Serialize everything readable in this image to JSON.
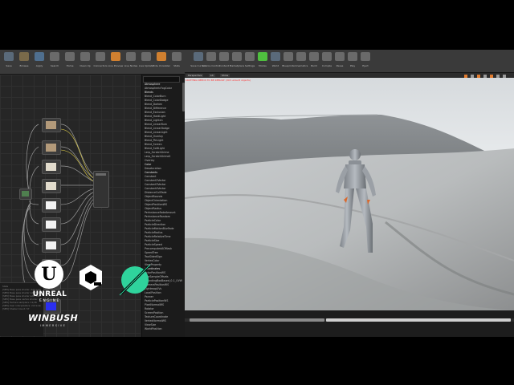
{
  "left_toolbar": {
    "buttons": [
      {
        "label": "Save",
        "color": "#5a6a7a"
      },
      {
        "label": "Browse",
        "color": "#7a6a4a"
      },
      {
        "label": "Apply",
        "color": "#4f6f8f"
      },
      {
        "label": "Search",
        "color": "#6a6a6a"
      },
      {
        "label": "Home",
        "color": "#6a6a6a"
      },
      {
        "label": "Clean Up",
        "color": "#6a6a6a"
      },
      {
        "label": "Connectors",
        "color": "#6a6a6a"
      },
      {
        "label": "Live Preview",
        "color": "#d08030"
      },
      {
        "label": "Live Nodes",
        "color": "#6a6a6a"
      },
      {
        "label": "Live Update",
        "color": "#6a6a6a"
      },
      {
        "label": "Hide Unrelated",
        "color": "#d08030"
      },
      {
        "label": "Stats",
        "color": "#6a6a6a"
      }
    ]
  },
  "material_list": {
    "items": [
      {
        "label": "Atmosphere",
        "cat": true
      },
      {
        "label": "AtmosphericFogColor",
        "cat": false
      },
      {
        "label": "Blends",
        "cat": true
      },
      {
        "label": "Blend_ColorBurn",
        "cat": false
      },
      {
        "label": "Blend_ColorDodge",
        "cat": false
      },
      {
        "label": "Blend_Darken",
        "cat": false
      },
      {
        "label": "Blend_Difference",
        "cat": false
      },
      {
        "label": "Blend_Exclusion",
        "cat": false
      },
      {
        "label": "Blend_HardLight",
        "cat": false
      },
      {
        "label": "Blend_Lighten",
        "cat": false
      },
      {
        "label": "Blend_LinearBurn",
        "cat": false
      },
      {
        "label": "Blend_LinearDodge",
        "cat": false
      },
      {
        "label": "Blend_LinearLight",
        "cat": false
      },
      {
        "label": "Blend_Overlay",
        "cat": false
      },
      {
        "label": "Blend_PinLight",
        "cat": false
      },
      {
        "label": "Blend_Screen",
        "cat": false
      },
      {
        "label": "Blend_SoftLight",
        "cat": false
      },
      {
        "label": "Lerp_ScratchGrime",
        "cat": false
      },
      {
        "label": "Lerp_ScratchGrime2",
        "cat": false
      },
      {
        "label": "Overlay",
        "cat": false
      },
      {
        "label": "Color",
        "cat": true
      },
      {
        "label": "Desaturation",
        "cat": false
      },
      {
        "label": "Constants",
        "cat": true
      },
      {
        "label": "Constant",
        "cat": false
      },
      {
        "label": "Constant2Vector",
        "cat": false
      },
      {
        "label": "Constant3Vector",
        "cat": false
      },
      {
        "label": "Constant4Vector",
        "cat": false
      },
      {
        "label": "DistanceCullFade",
        "cat": false
      },
      {
        "label": "ObjectBounds",
        "cat": false
      },
      {
        "label": "ObjectOrientation",
        "cat": false
      },
      {
        "label": "ObjectPositionWS",
        "cat": false
      },
      {
        "label": "ObjectRadius",
        "cat": false
      },
      {
        "label": "PerInstanceFadeAmount",
        "cat": false
      },
      {
        "label": "PerInstanceRandom",
        "cat": false
      },
      {
        "label": "ParticleColor",
        "cat": false
      },
      {
        "label": "ParticleDirection",
        "cat": false
      },
      {
        "label": "ParticleMotionBlurFade",
        "cat": false
      },
      {
        "label": "ParticleRadius",
        "cat": false
      },
      {
        "label": "ParticleRelativeTime",
        "cat": false
      },
      {
        "label": "ParticleSize",
        "cat": false
      },
      {
        "label": "ParticleSpeed",
        "cat": false
      },
      {
        "label": "PrecomputedAOMask",
        "cat": false
      },
      {
        "label": "SpeedTree",
        "cat": false
      },
      {
        "label": "TwoSidedSign",
        "cat": false
      },
      {
        "label": "VertexColor",
        "cat": false
      },
      {
        "label": "ViewProperty",
        "cat": false
      },
      {
        "label": "Coordinates",
        "cat": true
      },
      {
        "label": "ActorPositionWS",
        "cat": false
      },
      {
        "label": "BlurSampleOffsets",
        "cat": false
      },
      {
        "label": "BoundingBoxBased_0-1_UVW",
        "cat": false
      },
      {
        "label": "CameraPositionWS",
        "cat": false
      },
      {
        "label": "LightmapUVs",
        "cat": false
      },
      {
        "label": "LocalPosition",
        "cat": false
      },
      {
        "label": "Panner",
        "cat": false
      },
      {
        "label": "ParticlePositionWS",
        "cat": false
      },
      {
        "label": "PixelNormalWS",
        "cat": false
      },
      {
        "label": "Rotator",
        "cat": false
      },
      {
        "label": "ScreenPosition",
        "cat": false
      },
      {
        "label": "TextureCoordinate",
        "cat": false
      },
      {
        "label": "VertexNormalWS",
        "cat": false
      },
      {
        "label": "ViewSize",
        "cat": false
      },
      {
        "label": "WorldPosition",
        "cat": false
      }
    ]
  },
  "log": {
    "lines": [
      "Stats",
      "[SM5] Base pass shader: 243 instructions",
      "[SM5] Base pass shader with Surface Lightmap: 270",
      "[SM5] Base pass shader with Volumetric Lightmap: 263",
      "[SM5] Base pass vertex shader: 121 instructions",
      "[SM5] Texture samplers: 11/16",
      "[SM5] User interpolators: 2/4 Scalars",
      "[SM5] Shader Count: 57"
    ]
  },
  "logos": {
    "unreal_word": "UNREAL",
    "unreal_sub": "ENGINE",
    "winbush": "WINBUSH",
    "winbush_sub": "IMMERSIVE"
  },
  "right_toolbar": {
    "buttons": [
      {
        "label": "Save Current",
        "color": "#5a6a7a"
      },
      {
        "label": "Source Control",
        "color": "#6a6a6a"
      },
      {
        "label": "Content",
        "color": "#6a6a6a"
      },
      {
        "label": "Marketplace",
        "color": "#6a6a6a"
      },
      {
        "label": "Settings",
        "color": "#6a6a6a"
      },
      {
        "label": "Modes",
        "color": "#4fbf3f"
      },
      {
        "label": "World",
        "color": "#5a6a7a"
      },
      {
        "label": "Blueprints",
        "color": "#6a6a6a"
      },
      {
        "label": "Cinematics",
        "color": "#6a6a6a"
      },
      {
        "label": "Build",
        "color": "#6a6a6a"
      },
      {
        "label": "Compile",
        "color": "#6a6a6a"
      },
      {
        "label": "Pause",
        "color": "#6a6a6a"
      },
      {
        "label": "Play",
        "color": "#6a6a6a"
      },
      {
        "label": "Eject",
        "color": "#6a6a6a"
      }
    ]
  },
  "viewport": {
    "tabs": [
      "Perspective",
      "Lit",
      "Show"
    ],
    "warning": "LIGHTING NEEDS TO BE REBUILT (303 unbuilt objects)"
  }
}
